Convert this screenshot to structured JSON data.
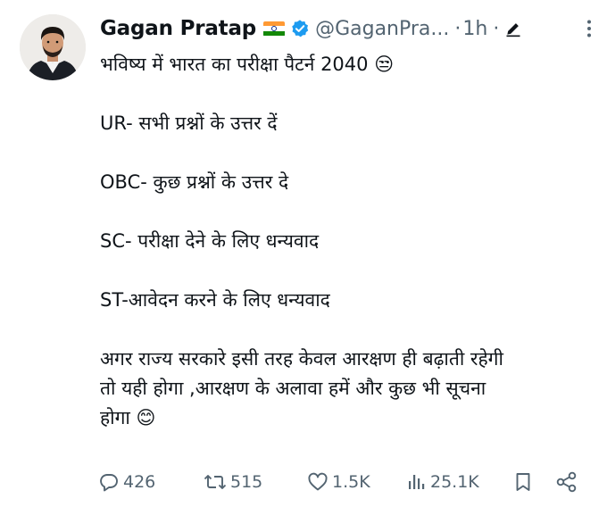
{
  "tweet": {
    "author_name": "Gagan Pratap",
    "flag_emoji": "🇮🇳",
    "handle": "@GaganPra...",
    "separator": "·",
    "time": "1h",
    "separator2": "·",
    "lines": [
      "भविष्य में भारत का परीक्षा पैटर्न 2040 😒",
      "",
      "UR- सभी प्रश्नों के उत्तर दें",
      "",
      "OBC- कुछ प्रश्नों के उत्तर दे",
      "",
      "SC- परीक्षा देने के लिए धन्यवाद",
      "",
      "ST-आवेदन करने के लिए धन्यवाद",
      "",
      "अगर राज्य सरकारे इसी तरह केवल आरक्षण ही बढ़ाती रहेगी",
      "तो यही होगा ,आरक्षण के अलावा हमें और कुछ भी सूचना",
      "होगा 😊"
    ]
  },
  "actions": {
    "replies": "426",
    "retweets": "515",
    "likes": "1.5K",
    "views": "25.1K"
  },
  "icons": {
    "verified": "verified-badge-icon",
    "edit": "edited-pencil-icon",
    "more": "more-options-icon",
    "reply": "reply-icon",
    "retweet": "retweet-icon",
    "like": "heart-icon",
    "views": "views-icon",
    "bookmark": "bookmark-icon",
    "share": "share-icon"
  },
  "colors": {
    "text": "#0f1419",
    "secondary": "#536471",
    "verified": "#1d9bf0"
  }
}
